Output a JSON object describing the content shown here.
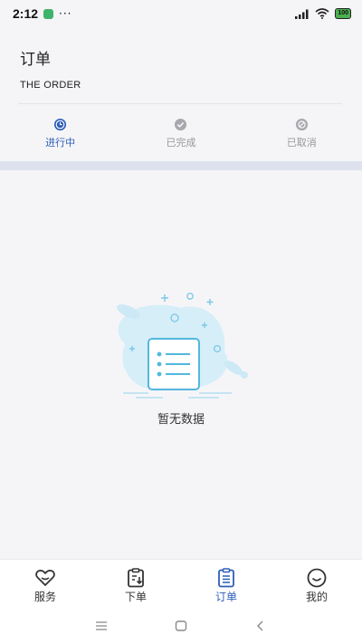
{
  "status_bar": {
    "time": "2:12",
    "dots": "···",
    "battery": "100"
  },
  "header": {
    "title": "订单",
    "subtitle": "THE ORDER"
  },
  "tabs": [
    {
      "label": "进行中",
      "icon": "clock-icon",
      "active": true
    },
    {
      "label": "已完成",
      "icon": "check-circle-icon",
      "active": false
    },
    {
      "label": "已取消",
      "icon": "cancel-circle-icon",
      "active": false
    }
  ],
  "empty_state": {
    "text": "暂无数据",
    "icon": "empty-list-illustration"
  },
  "bottom_nav": [
    {
      "label": "服务",
      "icon": "heart-icon",
      "active": false
    },
    {
      "label": "下单",
      "icon": "clipboard-download-icon",
      "active": false
    },
    {
      "label": "订单",
      "icon": "clipboard-list-icon",
      "active": true
    },
    {
      "label": "我的",
      "icon": "smile-icon",
      "active": false
    }
  ],
  "colors": {
    "accent": "#2e5fb8",
    "inactive": "#999999",
    "band": "#dde2ee",
    "background": "#f5f5f8"
  }
}
